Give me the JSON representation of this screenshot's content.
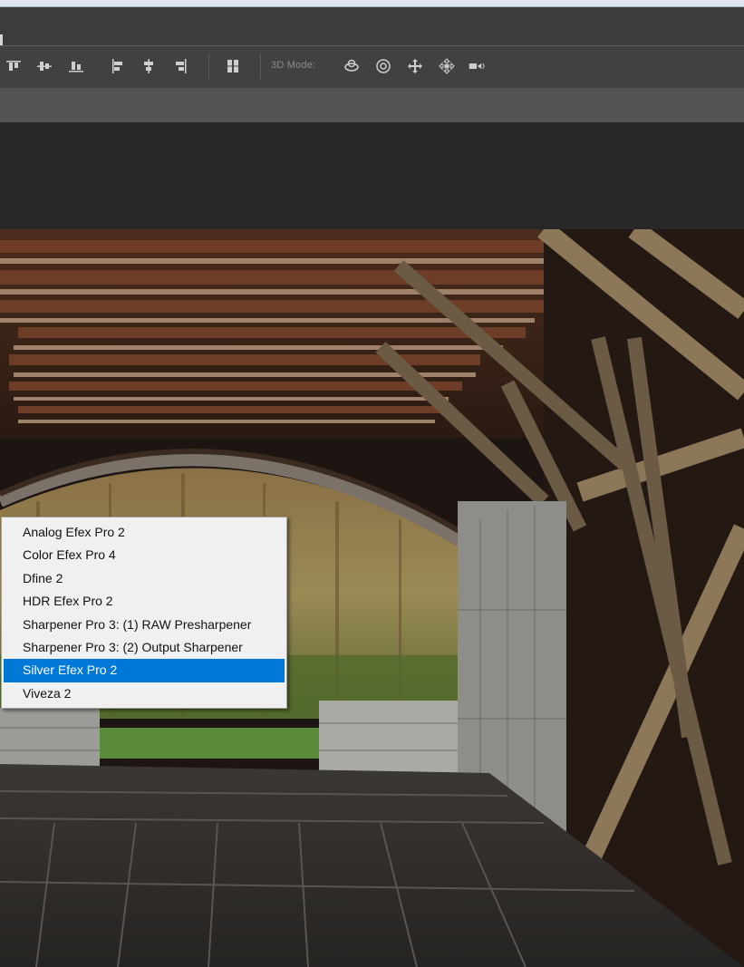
{
  "optionsbar": {
    "mode_label": "3D Mode:",
    "icons": [
      "align-top-edges-icon",
      "align-vertical-centers-icon",
      "align-bottom-edges-icon",
      "align-left-edges-icon",
      "align-horizontal-centers-icon",
      "align-right-edges-icon",
      "auto-align-layers-icon",
      "3d-orbit-icon",
      "3d-roll-icon",
      "3d-pan-icon",
      "3d-slide-icon",
      "3d-scale-icon"
    ]
  },
  "filter_menu": {
    "items": [
      {
        "label": "Analog Efex Pro 2"
      },
      {
        "label": "Color Efex Pro 4"
      },
      {
        "label": "Dfine 2"
      },
      {
        "label": "HDR Efex Pro 2"
      },
      {
        "label": "Sharpener Pro 3: (1) RAW Presharpener"
      },
      {
        "label": "Sharpener Pro 3: (2) Output Sharpener"
      },
      {
        "label": "Silver Efex Pro 2"
      },
      {
        "label": "Viveza 2"
      }
    ],
    "selected_index": 6,
    "highlight_color": "#0078d7"
  },
  "colors": {
    "titlebar": "#3c3c3c",
    "optionsbar": "#414141",
    "tabbar": "#535353",
    "workspace": "#282828"
  }
}
